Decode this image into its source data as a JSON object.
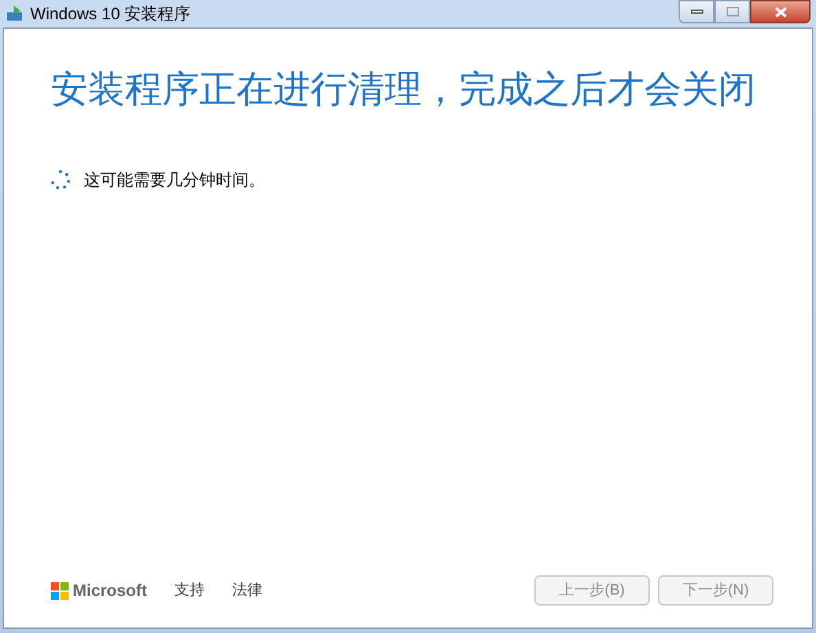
{
  "window": {
    "title": "Windows 10 安装程序"
  },
  "heading": "安装程序正在进行清理，完成之后才会关闭",
  "status": {
    "text": "这可能需要几分钟时间。"
  },
  "footer": {
    "brand": "Microsoft",
    "links": [
      "支持",
      "法律"
    ]
  },
  "buttons": [
    {
      "label": "上一步(B)",
      "disabled": true
    },
    {
      "label": "下一步(N)",
      "disabled": true
    }
  ]
}
